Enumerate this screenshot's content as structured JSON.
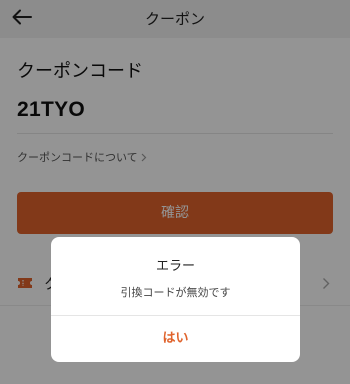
{
  "header": {
    "title": "クーポン"
  },
  "coupon_code": {
    "label": "クーポンコード",
    "value": "21TYO",
    "about_link": "クーポンコードについて"
  },
  "confirm_button": {
    "label": "確認"
  },
  "coupon_row": {
    "label": "ク",
    "icon": "ticket-icon"
  },
  "dialog": {
    "title": "エラー",
    "message": "引換コードが無効です",
    "ok_label": "はい"
  },
  "colors": {
    "accent": "#e0632c",
    "header_bg": "#f2f2f2",
    "overlay": "rgba(0,0,0,0.42)"
  }
}
